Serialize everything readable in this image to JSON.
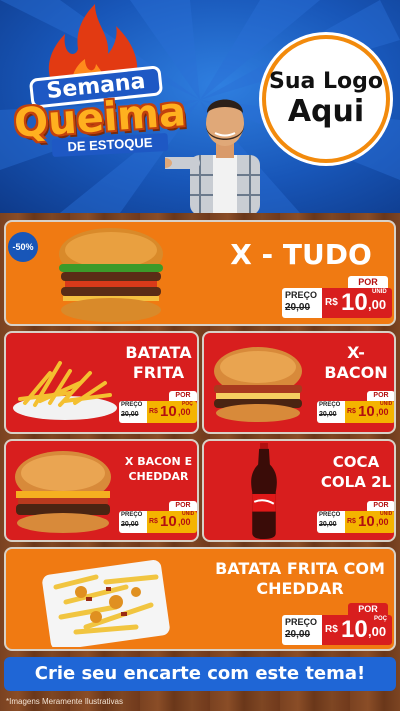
{
  "header": {
    "title_line1": "Semana",
    "title_line2": "Queima",
    "title_line3": "DE ESTOQUE",
    "logo_line1": "Sua Logo",
    "logo_line2": "Aqui"
  },
  "colors": {
    "header_blue": "#1856b8",
    "card_orange": "#f07a12",
    "card_red": "#d81e1e",
    "tag_yellow": "#f4b400",
    "cta_blue": "#1f66d6"
  },
  "products": [
    {
      "name": "X - TUDO",
      "badge": "-50%",
      "por": "POR",
      "preco": "PREÇO",
      "old": "20,00",
      "old_prefix": "R$",
      "currency": "R$",
      "price_int": "10",
      "price_cents": ",00",
      "unit": "UNID"
    },
    {
      "name_line1": "BATATA",
      "name_line2": "FRITA",
      "por": "POR",
      "preco": "PREÇO",
      "old": "20,00",
      "old_prefix": "R$",
      "currency": "R$",
      "price_int": "10",
      "price_cents": ",00",
      "unit": "POÇ"
    },
    {
      "name_line1": "X-",
      "name_line2": "BACON",
      "por": "POR",
      "preco": "PREÇO",
      "old": "20,00",
      "old_prefix": "R$",
      "currency": "R$",
      "price_int": "10",
      "price_cents": ",00",
      "unit": "UNID"
    },
    {
      "name_line1": "X BACON E",
      "name_line2": "CHEDDAR",
      "por": "POR",
      "preco": "PREÇO",
      "old": "20,00",
      "old_prefix": "R$",
      "currency": "R$",
      "price_int": "10",
      "price_cents": ",00",
      "unit": "UNID"
    },
    {
      "name_line1": "COCA",
      "name_line2": "COLA 2L",
      "por": "POR",
      "preco": "PREÇO",
      "old": "20,00",
      "old_prefix": "R$",
      "currency": "R$",
      "price_int": "10",
      "price_cents": ",00",
      "unit": "UNID"
    },
    {
      "name_line1": "BATATA FRITA COM",
      "name_line2": "CHEDDAR",
      "por": "POR",
      "preco": "PREÇO",
      "old": "20,00",
      "old_prefix": "R$",
      "currency": "R$",
      "price_int": "10",
      "price_cents": ",00",
      "unit": "POÇ"
    }
  ],
  "cta": "Crie seu encarte com este tema!",
  "disclaimer": "*Imagens Meramente Ilustrativas"
}
